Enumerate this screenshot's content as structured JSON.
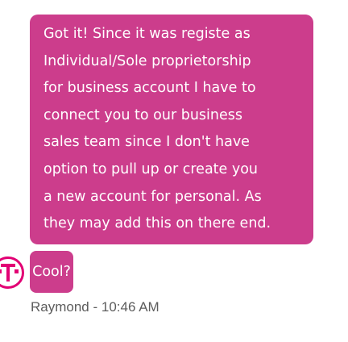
{
  "conversation": {
    "agent_avatar_icon": "t-mobile-logo-icon",
    "brand_color": "#e20074",
    "bubble_color": "#cc3d8c",
    "messages": [
      {
        "text": "Got it! Since it was registe as\nIndividual/Sole proprietorship\nfor business account I have to\nconnect you to our business\nsales team since I don't have\noption to pull up or create you\na new account for personal. As\nthey may add this on there end."
      },
      {
        "text": "Cool?"
      }
    ],
    "sender": "Raymond - 10:46 AM"
  }
}
